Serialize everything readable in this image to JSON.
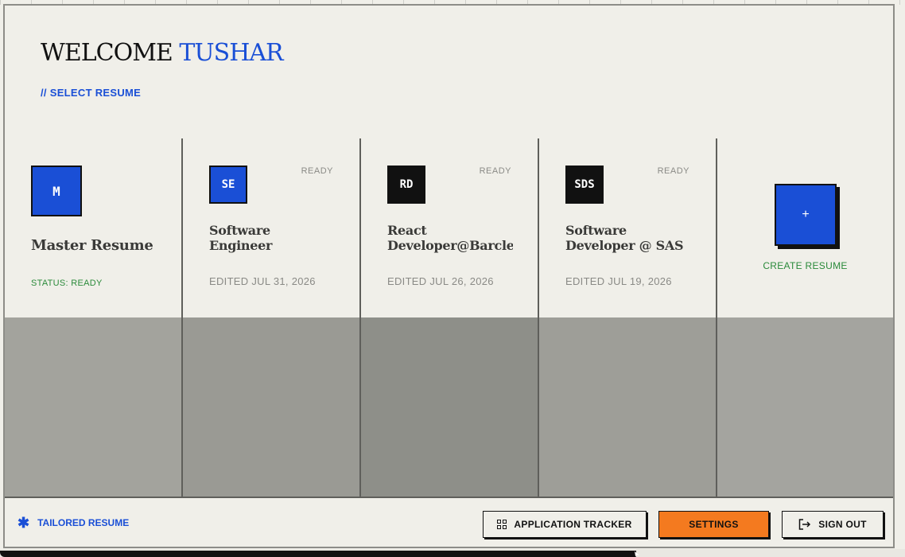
{
  "header": {
    "welcome": "WELCOME",
    "user_name": "TUSHAR",
    "select_label": "// SELECT RESUME"
  },
  "cards": [
    {
      "initials": "M",
      "title": "Master Resume",
      "status": "STATUS: READY",
      "badge_color": "#1a4fd6"
    },
    {
      "initials": "SE",
      "title": "Software Engineer",
      "ready": "READY",
      "edited": "EDITED JUL 31, 2026",
      "badge_color": "#1a4fd6"
    },
    {
      "initials": "RD",
      "title": "React Developer@Barcleys",
      "ready": "READY",
      "edited": "EDITED JUL 26, 2026",
      "badge_color": "#111111"
    },
    {
      "initials": "SDS",
      "title": "Software Developer @ SAS",
      "ready": "READY",
      "edited": "EDITED JUL 19, 2026",
      "badge_color": "#111111"
    }
  ],
  "create": {
    "icon": "+",
    "label": "CREATE RESUME"
  },
  "preview_colors": [
    "#a3a39d",
    "#9a9a94",
    "#8e8f89",
    "#9e9e98",
    "#a4a49f"
  ],
  "footer": {
    "tailored_label": "TAILORED RESUME",
    "tracker_label": "APPLICATION TRACKER",
    "settings_label": "SETTINGS",
    "signout_label": "SIGN OUT"
  },
  "colors": {
    "accent": "#1a4fd6",
    "status_green": "#2a8a3a",
    "settings_orange": "#f47a1f"
  }
}
